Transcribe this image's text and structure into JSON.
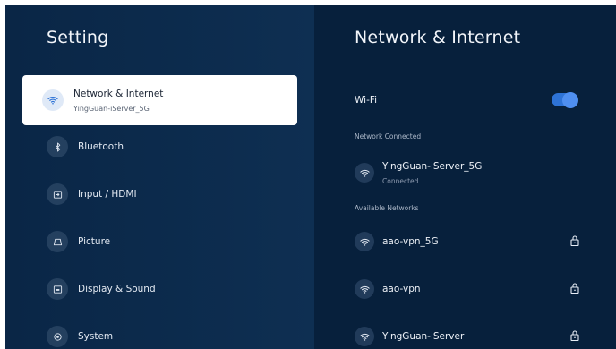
{
  "left": {
    "title": "Setting",
    "items": [
      {
        "label": "Network & Internet",
        "sublabel": "YingGuan-iServer_5G",
        "icon": "wifi-icon",
        "active": true
      },
      {
        "label": "Bluetooth",
        "icon": "bluetooth-icon"
      },
      {
        "label": "Input / HDMI",
        "icon": "input-icon"
      },
      {
        "label": "Picture",
        "icon": "picture-icon"
      },
      {
        "label": "Display & Sound",
        "icon": "display-icon"
      },
      {
        "label": "System",
        "icon": "system-icon"
      }
    ]
  },
  "right": {
    "title": "Network & Internet",
    "wifi": {
      "label": "Wi-Fi",
      "enabled": true
    },
    "connected_header": "Network Connected",
    "connected": {
      "name": "YingGuan-iServer_5G",
      "status": "Connected"
    },
    "available_header": "Available Networks",
    "networks": [
      {
        "name": "aao-vpn_5G",
        "locked": true
      },
      {
        "name": "aao-vpn",
        "locked": true
      },
      {
        "name": "YingGuan-iServer",
        "locked": true
      }
    ]
  },
  "colors": {
    "accent": "#2e73d6",
    "left_bg": "#0e2f52",
    "right_bg": "#07203c"
  }
}
